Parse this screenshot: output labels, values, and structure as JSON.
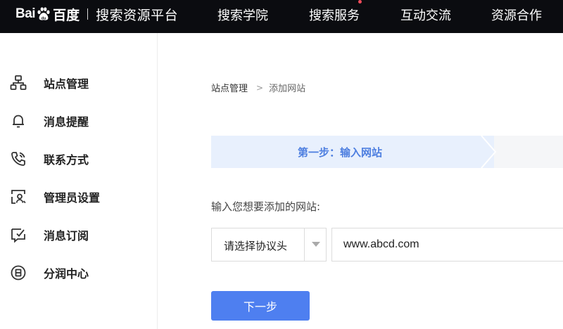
{
  "header": {
    "logo": {
      "bai": "Bai",
      "du": "du",
      "chinese": "百度"
    },
    "platform_title": "搜索资源平台",
    "nav": [
      {
        "label": "搜索学院"
      },
      {
        "label": "搜索服务",
        "has_notification": true
      },
      {
        "label": "互动交流"
      },
      {
        "label": "资源合作"
      }
    ]
  },
  "sidebar": {
    "items": [
      {
        "label": "站点管理",
        "icon": "sitemap-icon"
      },
      {
        "label": "消息提醒",
        "icon": "bell-icon"
      },
      {
        "label": "联系方式",
        "icon": "phone-icon"
      },
      {
        "label": "管理员设置",
        "icon": "admin-icon"
      },
      {
        "label": "消息订阅",
        "icon": "subscribe-icon"
      },
      {
        "label": "分润中心",
        "icon": "revenue-icon"
      }
    ]
  },
  "main": {
    "breadcrumb": {
      "parent": "站点管理",
      "separator": ">",
      "current": "添加网站"
    },
    "steps": [
      {
        "label": "第一步：输入网站",
        "active": true
      },
      {
        "label": "",
        "active": false
      }
    ],
    "field_label": "输入您想要添加的网站:",
    "protocol_select": {
      "placeholder": "请选择协议头"
    },
    "url_input": {
      "value": "www.abcd.com"
    },
    "next_button": "下一步"
  },
  "colors": {
    "topbar": "#0b0c10",
    "accent": "#4e7ff0",
    "step_active_bg": "#e8f0fd",
    "step_active_text": "#4e7fe0",
    "notification_dot": "#f04b5a"
  }
}
